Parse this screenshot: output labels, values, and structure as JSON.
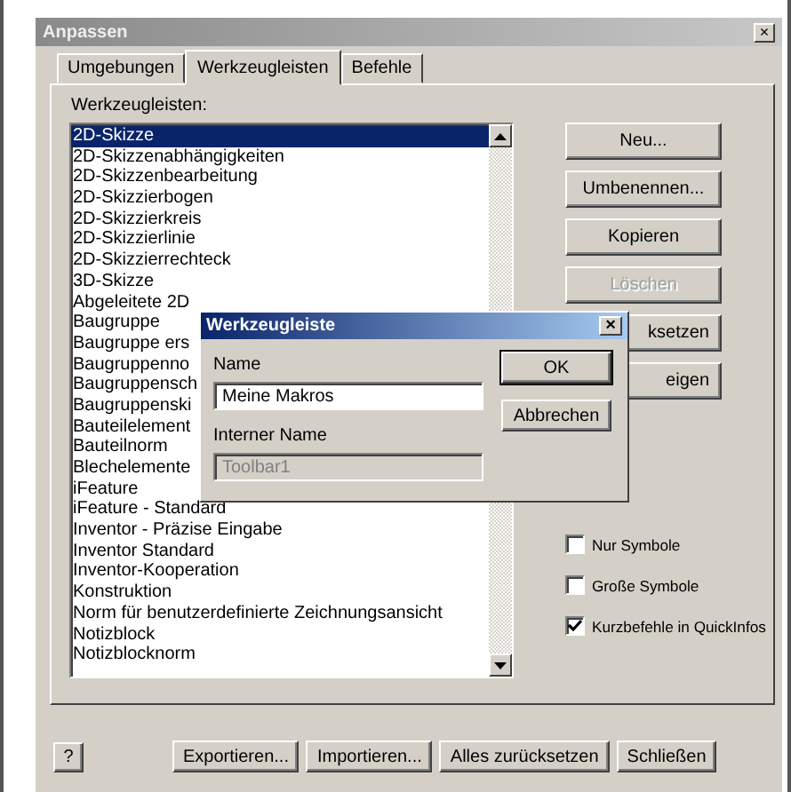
{
  "window": {
    "title": "Anpassen",
    "close": "×"
  },
  "tabs": [
    {
      "label": "Umgebungen",
      "selected": false
    },
    {
      "label": "Werkzeugleisten",
      "selected": true
    },
    {
      "label": "Befehle",
      "selected": false
    }
  ],
  "list_label": "Werkzeugleisten:",
  "toolbars": [
    {
      "label": "2D-Skizze",
      "selected": true
    },
    {
      "label": "2D-Skizzenabhängigkeiten",
      "selected": false
    },
    {
      "label": "2D-Skizzenbearbeitung",
      "selected": false
    },
    {
      "label": "2D-Skizzierbogen",
      "selected": false
    },
    {
      "label": "2D-Skizzierkreis",
      "selected": false
    },
    {
      "label": "2D-Skizzierlinie",
      "selected": false
    },
    {
      "label": "2D-Skizzierrechteck",
      "selected": false
    },
    {
      "label": "3D-Skizze",
      "selected": false
    },
    {
      "label": "Abgeleitete 2D",
      "selected": false
    },
    {
      "label": "Baugruppe",
      "selected": false
    },
    {
      "label": "Baugruppe ers",
      "selected": false
    },
    {
      "label": "Baugruppenno",
      "selected": false
    },
    {
      "label": "Baugruppensch",
      "selected": false
    },
    {
      "label": "Baugruppenski",
      "selected": false
    },
    {
      "label": "Bauteilelement",
      "selected": false
    },
    {
      "label": "Bauteilnorm",
      "selected": false
    },
    {
      "label": "Blechelemente",
      "selected": false
    },
    {
      "label": "iFeature",
      "selected": false
    },
    {
      "label": "iFeature - Standard",
      "selected": false
    },
    {
      "label": "Inventor - Präzise Eingabe",
      "selected": false
    },
    {
      "label": "Inventor Standard",
      "selected": false
    },
    {
      "label": "Inventor-Kooperation",
      "selected": false
    },
    {
      "label": "Konstruktion",
      "selected": false
    },
    {
      "label": "Norm für benutzerdefinierte Zeichnungsansicht",
      "selected": false
    },
    {
      "label": "Notizblock",
      "selected": false
    },
    {
      "label": "Notizblocknorm",
      "selected": false
    }
  ],
  "side_buttons": [
    {
      "label": "Neu...",
      "disabled": false,
      "partial": false
    },
    {
      "label": "Umbenennen...",
      "disabled": false,
      "partial": false
    },
    {
      "label": "Kopieren",
      "disabled": false,
      "partial": false
    },
    {
      "label": "Löschen",
      "disabled": true,
      "partial": false
    },
    {
      "label": "ksetzen",
      "disabled": false,
      "partial": true
    },
    {
      "label": "eigen",
      "disabled": false,
      "partial": true
    }
  ],
  "options": [
    {
      "label": "Nur Symbole",
      "checked": false
    },
    {
      "label": "Große Symbole",
      "checked": false
    },
    {
      "label": "Kurzbefehle in QuickInfos",
      "checked": true
    }
  ],
  "footer": {
    "help": "?",
    "buttons": [
      "Exportieren...",
      "Importieren...",
      "Alles zurücksetzen",
      "Schließen"
    ]
  },
  "dialog": {
    "title": "Werkzeugleiste",
    "close": "×",
    "name_label": "Name",
    "name_value": "Meine Makros",
    "internal_label": "Interner Name",
    "internal_value": "Toolbar1",
    "internal_disabled": true,
    "buttons": [
      "OK",
      "Abbrechen"
    ]
  }
}
